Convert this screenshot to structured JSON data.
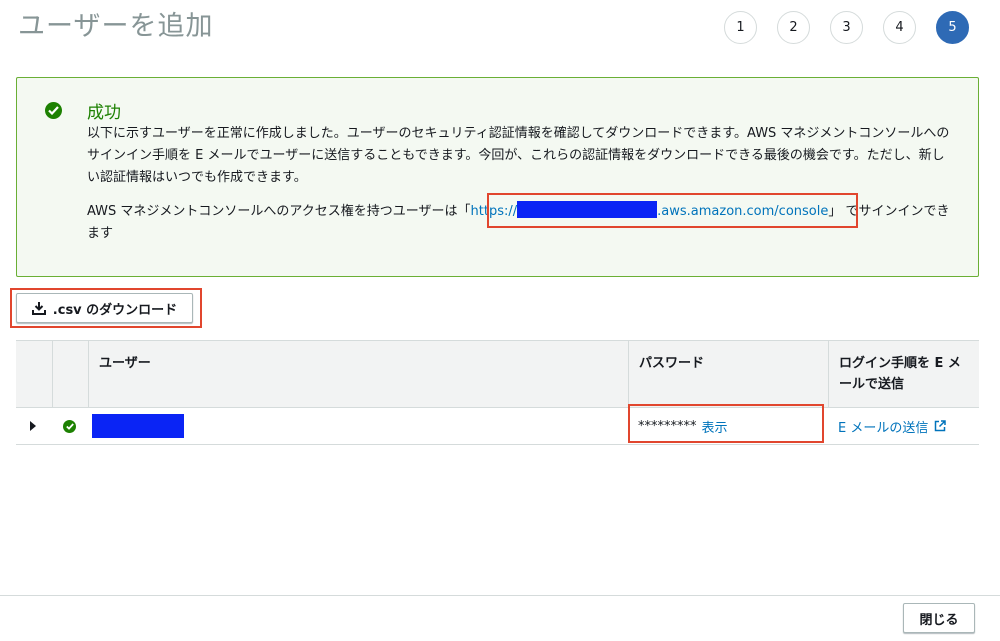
{
  "page": {
    "title": "ユーザーを追加"
  },
  "steps": [
    "1",
    "2",
    "3",
    "4",
    "5"
  ],
  "alert": {
    "title": "成功",
    "body": "以下に示すユーザーを正常に作成しました。ユーザーのセキュリティ認証情報を確認してダウンロードできます。AWS マネジメントコンソールへのサインイン手順を E メールでユーザーに送信することもできます。今回が、これらの認証情報をダウンロードできる最後の機会です。ただし、新しい認証情報はいつでも作成できます。",
    "access_prefix": "AWS マネジメントコンソールへのアクセス権を持つユーザーは",
    "bracket_open": "「",
    "url_start": "https://",
    "url_end": ".aws.amazon.com/console",
    "bracket_close": "」",
    "access_suffix": "でサインインできます"
  },
  "toolbar": {
    "csv_label": ".csv のダウンロード"
  },
  "table": {
    "headers": {
      "user": "ユーザー",
      "password": "パスワード",
      "login": "ログイン手順を E メールで送信"
    },
    "rows": [
      {
        "password_masked": "*********",
        "show_label": "表示",
        "email_label": "E メールの送信"
      }
    ]
  },
  "footer": {
    "close_label": "閉じる"
  },
  "colors": {
    "accent": "#2e6ab5",
    "success": "#1d8102",
    "link": "#0073bb",
    "highlight": "#e1462e",
    "redaction": "#0a24f5"
  }
}
